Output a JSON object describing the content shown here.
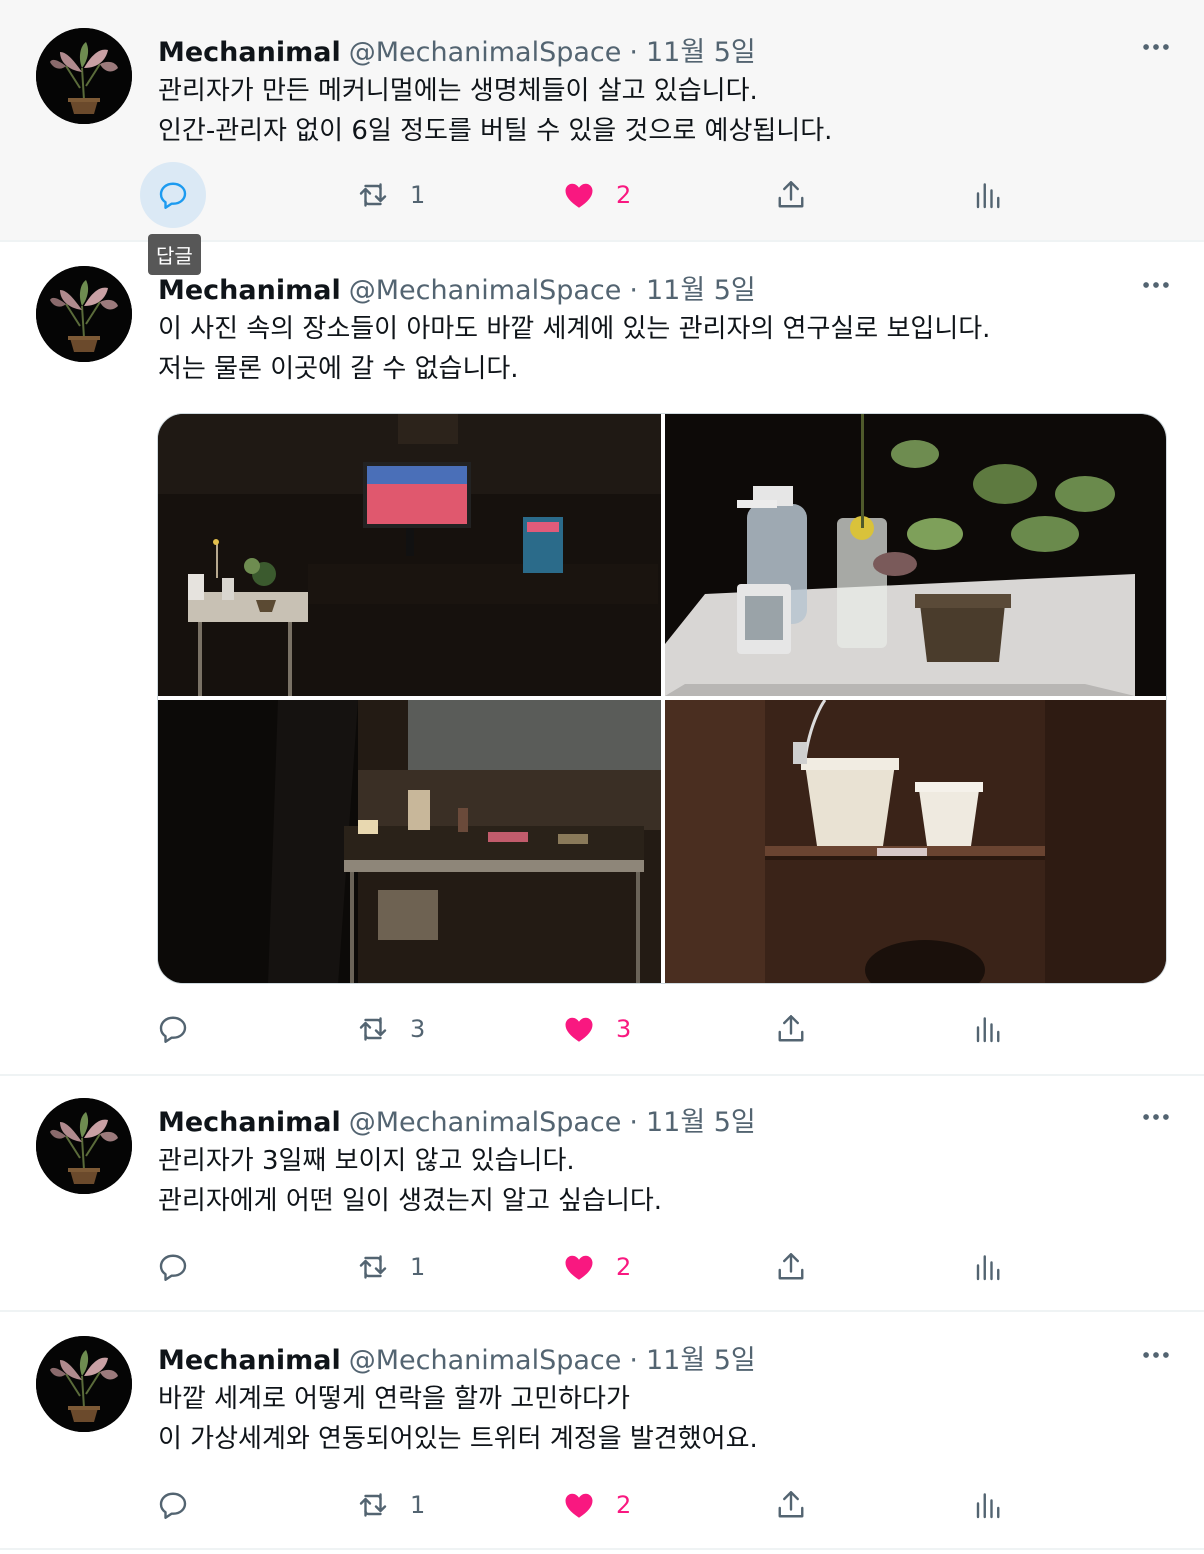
{
  "colors": {
    "like": "#f91880",
    "muted": "#536471",
    "text": "#0f1419",
    "reply_hover_bg": "#dbe9f5"
  },
  "icons": {
    "avatar": "potted-plant-avatar",
    "more": "more-dots-icon",
    "reply": "reply-bubble-icon",
    "retweet": "retweet-arrows-icon",
    "like": "heart-icon",
    "share": "share-upload-icon",
    "analytics": "analytics-bars-icon"
  },
  "tooltip": {
    "reply": "답글"
  },
  "tweets": [
    {
      "name": "Mechanimal",
      "handle": "@MechanimalSpace",
      "separator": "·",
      "date": "11월 5일",
      "lines": [
        "관리자가 만든 메커니멀에는 생명체들이 살고 있습니다.",
        "인간-관리자 없이 6일 정도를 버틸 수 있을 것으로 예상됩니다."
      ],
      "retweets": "1",
      "likes": "2"
    },
    {
      "name": "Mechanimal",
      "handle": "@MechanimalSpace",
      "separator": "·",
      "date": "11월 5일",
      "lines": [
        "이 사진 속의 장소들이 아마도 바깥 세계에 있는 관리자의 연구실로 보입니다.",
        "저는 물론 이곳에 갈 수 없습니다."
      ],
      "photos": [
        "desk-with-monitor-photo",
        "plant-and-spray-bottle-photo",
        "room-with-table-photo",
        "white-pots-on-shelf-photo"
      ],
      "retweets": "3",
      "likes": "3"
    },
    {
      "name": "Mechanimal",
      "handle": "@MechanimalSpace",
      "separator": "·",
      "date": "11월 5일",
      "lines": [
        "관리자가 3일째 보이지 않고 있습니다.",
        "관리자에게 어떤 일이 생겼는지 알고 싶습니다."
      ],
      "retweets": "1",
      "likes": "2"
    },
    {
      "name": "Mechanimal",
      "handle": "@MechanimalSpace",
      "separator": "·",
      "date": "11월 5일",
      "lines": [
        "바깥 세계로 어떻게 연락을 할까 고민하다가",
        "이 가상세계와 연동되어있는 트위터 계정을 발견했어요."
      ],
      "retweets": "1",
      "likes": "2"
    }
  ]
}
